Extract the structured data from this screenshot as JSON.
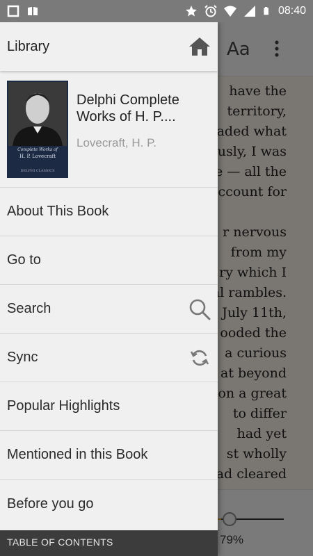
{
  "status_bar": {
    "time": "08:40",
    "icons": [
      "square-icon",
      "book-icon",
      "star-icon",
      "alarm-icon",
      "wifi-icon",
      "signal-icon",
      "battery-icon"
    ]
  },
  "reader": {
    "font_button_label": "Aa",
    "text_lines": [
      "have   the",
      "territory,",
      "aded  what",
      "usly,  I  was",
      "e — all the",
      "account for",
      "",
      "r   nervous",
      "from   my",
      "ry which I",
      "al rambles.",
      "July 11th,",
      "ooded  the",
      "a   curious",
      "at  beyond",
      "on  a great",
      "to    differ",
      "had    yet",
      "st    wholly",
      "ad  cleared"
    ],
    "progress_percent": 79,
    "progress_label": "79%"
  },
  "drawer": {
    "header_title": "Library",
    "book": {
      "title": "Delphi Complete Works of H. P....",
      "author": "Lovecraft, H. P.",
      "cover_line1": "Complete Works of",
      "cover_line2": "H. P. Lovecraft",
      "cover_line3": "DELPHI CLASSICS"
    },
    "menu_items": [
      {
        "label": "About This Book",
        "icon": ""
      },
      {
        "label": "Go to",
        "icon": ""
      },
      {
        "label": "Search",
        "icon": "search-icon"
      },
      {
        "label": "Sync",
        "icon": "sync-icon"
      },
      {
        "label": "Popular Highlights",
        "icon": ""
      },
      {
        "label": "Mentioned in this Book",
        "icon": ""
      },
      {
        "label": "Before you go",
        "icon": ""
      }
    ],
    "toc_label": "TABLE OF CONTENTS"
  },
  "colors": {
    "drawer_bg": "#f0f0f0",
    "toc_bar_bg": "#3c3c3c",
    "status_bar_bg": "#7a7a7a",
    "progress_accent": "#e8a23a"
  }
}
